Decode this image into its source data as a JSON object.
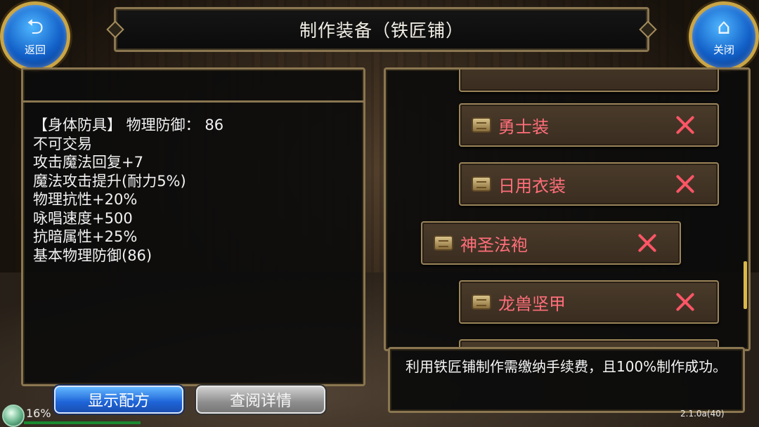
{
  "header": {
    "title": "制作装备（铁匠铺）",
    "back_label": "返回",
    "back_icon": "return-arrow-icon",
    "close_label": "关闭",
    "close_icon": "house-icon"
  },
  "item_info": {
    "lines": [
      "【身体防具】 物理防御： 86",
      "不可交易",
      "攻击魔法回复+7",
      "魔法攻击提升(耐力5%)",
      "物理抗性+20%",
      "咏唱速度+500",
      "抗暗属性+25%",
      "基本物理防御(86)"
    ]
  },
  "recipes": {
    "items": [
      {
        "name": "勇士装",
        "selected": false
      },
      {
        "name": "日用衣装",
        "selected": false
      },
      {
        "name": "神圣法袍",
        "selected": true
      },
      {
        "name": "龙兽坚甲",
        "selected": false
      }
    ],
    "item_icon": "scroll-icon",
    "remove_icon": "close-x-icon"
  },
  "notice": {
    "text": "利用铁匠铺制作需缴纳手续费，且100%制作成功。"
  },
  "buttons": {
    "show_recipe": "显示配方",
    "view_detail": "查阅详情"
  },
  "status": {
    "progress_text": "16%",
    "progress_value": 0.16,
    "version": "2.1.0a(40)"
  },
  "colors": {
    "item_name": "#ff6e7a",
    "frame_gold": "#8a7650",
    "primary_button": "#1e64d8"
  }
}
